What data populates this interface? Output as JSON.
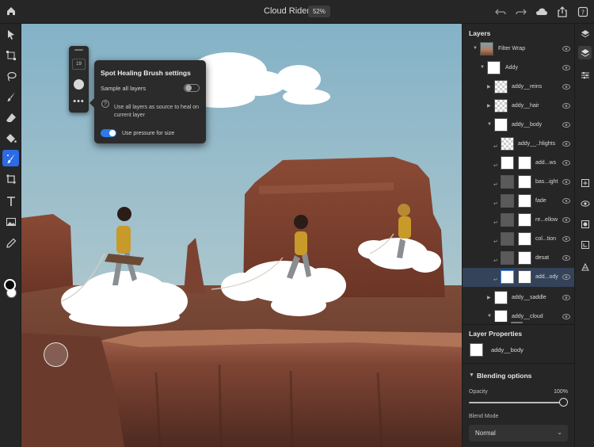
{
  "document": {
    "title": "Cloud Riders",
    "zoom": "52%"
  },
  "brush_panel": {
    "size": "19",
    "more_label": "•••"
  },
  "settings_popover": {
    "title": "Spot Healing Brush settings",
    "sample_all_layers_label": "Sample all layers",
    "sample_all_layers_on": false,
    "description": "Use all layers as source to heal on current layer",
    "use_pressure_label": "Use pressure for size",
    "use_pressure_on": true
  },
  "layers_panel": {
    "title": "Layers",
    "layers": [
      {
        "name": "Filter Wrap"
      },
      {
        "name": "Addy"
      },
      {
        "name": "addy__reins"
      },
      {
        "name": "addy__hair"
      },
      {
        "name": "addy__body"
      },
      {
        "name": "addy__..hlights"
      },
      {
        "name": "add...ws"
      },
      {
        "name": "bas...ight"
      },
      {
        "name": "fade"
      },
      {
        "name": "re...ellow"
      },
      {
        "name": "col...tion"
      },
      {
        "name": "desat"
      },
      {
        "name": "add...ody"
      },
      {
        "name": "addy__saddle"
      },
      {
        "name": "addy__cloud"
      }
    ]
  },
  "layer_properties": {
    "title": "Layer Properties",
    "layer_name": "addy__body",
    "blending_title": "Blending options",
    "opacity_label": "Opacity",
    "opacity_value": "100%",
    "blend_mode_label": "Blend Mode",
    "blend_mode_value": "Normal"
  },
  "icons": {
    "top": [
      "home-icon",
      "undo-icon",
      "redo-icon",
      "cloud-icon",
      "share-icon",
      "help-icon"
    ],
    "left_tools": [
      "move-icon",
      "transform-icon",
      "lasso-icon",
      "brush-icon",
      "eraser-icon",
      "fill-icon",
      "spot-healing-icon",
      "crop-icon",
      "type-icon",
      "image-icon",
      "eyedropper-icon"
    ],
    "right_strip": [
      "layers-icon",
      "layer-properties-icon",
      "adjustments-icon",
      "add-layer-icon",
      "visibility-icon",
      "mask-icon",
      "clip-icon",
      "more-icon"
    ]
  },
  "colors": {
    "accent": "#2d6ae3",
    "toggle_on": "#2d7be5",
    "panel_bg": "#262626"
  }
}
